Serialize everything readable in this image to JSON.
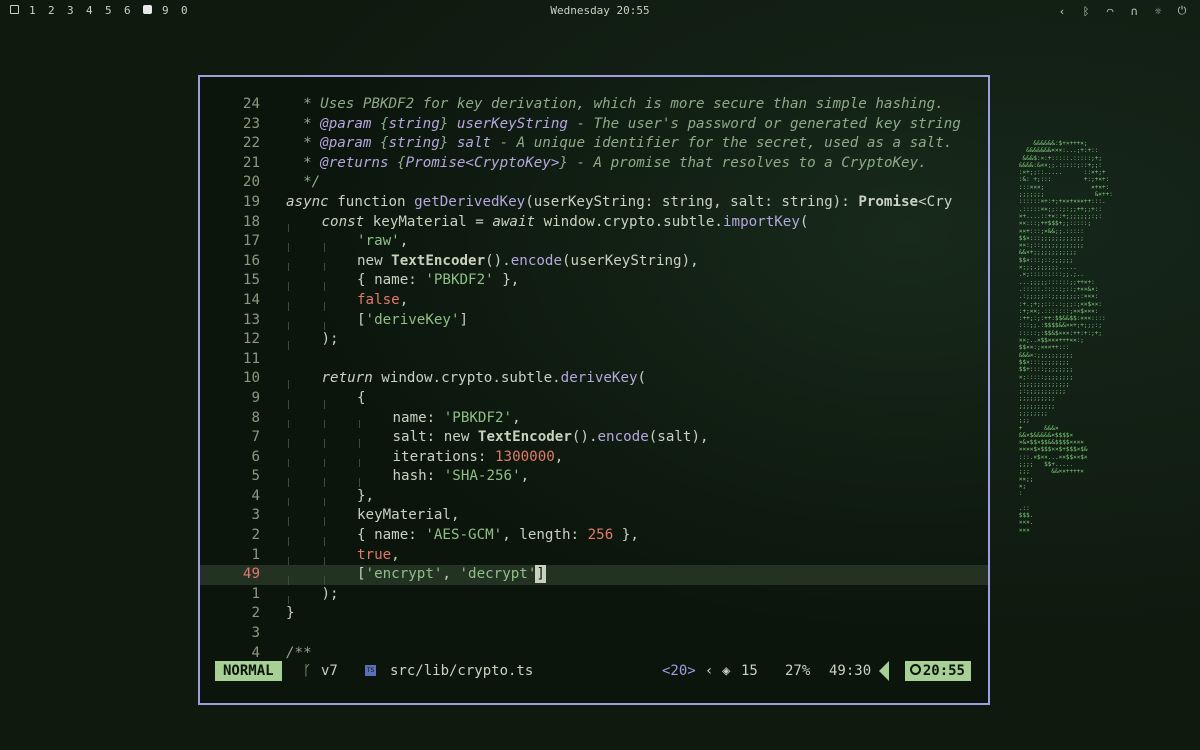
{
  "topbar": {
    "workspaces": [
      "1",
      "2",
      "3",
      "4",
      "5",
      "6",
      "9",
      "0"
    ],
    "active_workspace_index": 6,
    "clock": "Wednesday 20:55",
    "tray_icons": [
      "chevron-left-icon",
      "bluetooth-icon",
      "wifi-icon",
      "headphones-icon",
      "brightness-icon",
      "power-icon"
    ]
  },
  "editor": {
    "lines": [
      {
        "num": "24",
        "cur": false,
        "html": "<span class=\"cm\">  * Uses PBKDF2 for key derivation, which is more secure than simple hashing.</span>"
      },
      {
        "num": "23",
        "cur": false,
        "html": "<span class=\"cm\">  * </span><span class=\"cmk\">@param</span><span class=\"cm\"> {</span><span class=\"cmk\">string</span><span class=\"cm\">} </span><span class=\"cmk\">userKeyString</span><span class=\"cm\"> - The user's password or generated key string</span>"
      },
      {
        "num": "22",
        "cur": false,
        "html": "<span class=\"cm\">  * </span><span class=\"cmk\">@param</span><span class=\"cm\"> {</span><span class=\"cmk\">string</span><span class=\"cm\">} </span><span class=\"cmk\">salt</span><span class=\"cm\"> - A unique identifier for the secret, used as a salt.</span>"
      },
      {
        "num": "21",
        "cur": false,
        "html": "<span class=\"cm\">  * </span><span class=\"cmk\">@returns</span><span class=\"cm\"> {</span><span class=\"cmk\">Promise&lt;CryptoKey&gt;</span><span class=\"cm\">} - A promise that resolves to a CryptoKey.</span>"
      },
      {
        "num": "20",
        "cur": false,
        "html": "<span class=\"cm\">  */</span>"
      },
      {
        "num": "19",
        "cur": false,
        "html": "<span class=\"kwi\">async</span><span class=\"kw\"> function </span><span class=\"fn\">getDerivedKey</span><span class=\"plain\">(userKeyString: string, salt: string): </span><span class=\"bold\">Promise</span><span class=\"plain\">&lt;Cry</span>"
      },
      {
        "num": "18",
        "cur": false,
        "html": "<span class=\"guide\"></span><span class=\"kwi\">const</span><span class=\"plain\"> keyMaterial = </span><span class=\"kwi\">await</span><span class=\"plain\"> window.crypto.subtle.</span><span class=\"fn\">importKey</span><span class=\"plain\">(</span>"
      },
      {
        "num": "17",
        "cur": false,
        "html": "<span class=\"guide\"></span><span class=\"guide\"></span><span class=\"str\">'raw'</span><span class=\"plain\">,</span>"
      },
      {
        "num": "16",
        "cur": false,
        "html": "<span class=\"guide\"></span><span class=\"guide\"></span><span class=\"plain\">new </span><span class=\"bold\">TextEncoder</span><span class=\"plain\">().</span><span class=\"fn\">encode</span><span class=\"plain\">(userKeyString),</span>"
      },
      {
        "num": "15",
        "cur": false,
        "html": "<span class=\"guide\"></span><span class=\"guide\"></span><span class=\"plain\">{ name: </span><span class=\"str\">'PBKDF2'</span><span class=\"plain\"> },</span>"
      },
      {
        "num": "14",
        "cur": false,
        "html": "<span class=\"guide\"></span><span class=\"guide\"></span><span class=\"bool\">false</span><span class=\"plain\">,</span>"
      },
      {
        "num": "13",
        "cur": false,
        "html": "<span class=\"guide\"></span><span class=\"guide\"></span><span class=\"plain\">[</span><span class=\"str\">'deriveKey'</span><span class=\"plain\">]</span>"
      },
      {
        "num": "12",
        "cur": false,
        "html": "<span class=\"guide\"></span><span class=\"plain\">);</span>"
      },
      {
        "num": "11",
        "cur": false,
        "html": ""
      },
      {
        "num": "10",
        "cur": false,
        "html": "<span class=\"guide\"></span><span class=\"kwi\">return</span><span class=\"plain\"> window.crypto.subtle.</span><span class=\"fn\">deriveKey</span><span class=\"plain\">(</span>"
      },
      {
        "num": "9",
        "cur": false,
        "html": "<span class=\"guide\"></span><span class=\"guide\"></span><span class=\"plain\">{</span>"
      },
      {
        "num": "8",
        "cur": false,
        "html": "<span class=\"guide\"></span><span class=\"guide\"></span><span class=\"guide\"></span><span class=\"plain\">name: </span><span class=\"str\">'PBKDF2'</span><span class=\"plain\">,</span>"
      },
      {
        "num": "7",
        "cur": false,
        "html": "<span class=\"guide\"></span><span class=\"guide\"></span><span class=\"guide\"></span><span class=\"plain\">salt: new </span><span class=\"bold\">TextEncoder</span><span class=\"plain\">().</span><span class=\"fn\">encode</span><span class=\"plain\">(salt),</span>"
      },
      {
        "num": "6",
        "cur": false,
        "html": "<span class=\"guide\"></span><span class=\"guide\"></span><span class=\"guide\"></span><span class=\"plain\">iterations: </span><span class=\"num\">1300000</span><span class=\"plain\">,</span>"
      },
      {
        "num": "5",
        "cur": false,
        "html": "<span class=\"guide\"></span><span class=\"guide\"></span><span class=\"guide\"></span><span class=\"plain\">hash: </span><span class=\"str\">'SHA-256'</span><span class=\"plain\">,</span>"
      },
      {
        "num": "4",
        "cur": false,
        "html": "<span class=\"guide\"></span><span class=\"guide\"></span><span class=\"plain\">},</span>"
      },
      {
        "num": "3",
        "cur": false,
        "html": "<span class=\"guide\"></span><span class=\"guide\"></span><span class=\"plain\">keyMaterial,</span>"
      },
      {
        "num": "2",
        "cur": false,
        "html": "<span class=\"guide\"></span><span class=\"guide\"></span><span class=\"plain\">{ name: </span><span class=\"str\">'AES-GCM'</span><span class=\"plain\">, length: </span><span class=\"num\">256</span><span class=\"plain\"> },</span>"
      },
      {
        "num": "1",
        "cur": false,
        "html": "<span class=\"guide\"></span><span class=\"guide\"></span><span class=\"bool\">true</span><span class=\"plain\">,</span>"
      },
      {
        "num": "49",
        "cur": true,
        "html": "<span class=\"guide\"></span><span class=\"guide\"></span><span class=\"plain\">[</span><span class=\"str\">'encrypt'</span><span class=\"plain\">, </span><span class=\"str\">'decrypt'</span><span class=\"cur-box\">]</span>"
      },
      {
        "num": "1",
        "cur": false,
        "html": "<span class=\"guide\"></span><span class=\"plain\">);</span>"
      },
      {
        "num": "2",
        "cur": false,
        "html": "<span class=\"plain\">}</span>"
      },
      {
        "num": "3",
        "cur": false,
        "html": ""
      },
      {
        "num": "4",
        "cur": false,
        "html": "<span class=\"cm\">/**</span>"
      }
    ]
  },
  "statusline": {
    "mode": "NORMAL",
    "branch": "v7",
    "filetype_badge": "TS",
    "file": "src/lib/crypto.ts",
    "lsp": "<20>",
    "diagnostics": "15",
    "percent": "27%",
    "position": "49:30",
    "time": "20:55"
  },
  "ascii_art": "            &&&&&&:$+×+++×;\n          &&&&&&&×××:...;+:+::\n         &&&$:×:+:::::.:::::;+;\n        &&&&:&××;;.:::::;::+;;:\n        :×+;;::.....      ::×+;+\n        :&: +;:::         +:;+×+:\n        :::×××;             ×+×+:\n        ;;;;;;;              &×++:\n        ::::::×+:+;+××+×××++:::.\n        .:::::××;;::;:;;++;;+::\n        ×+....::+×::+;;;;;;;:;:\n        ××:::;++$$$+;;:::::;\n        ××+:::;×&&;;.:::::\n        $$×:::;;;;;;;;;;;;\n        ××:;::;;;;;;;;;;;;\n        &&×+;;;;;;;;;;;;\n        $$×:::;::;;;;;;\n        ×;;;.;;;;;;.....\n        .×;:::::::::;;.;..\n        ...;;;;;::::::;;++×+:\n        .:::::.:::::;::;+××&×:\n        .:;;;;;::;;;;;;;;:×××:\n        :+.;+;;:::.:;;;:;××$××:\n        :+;××;.:::::::;××$×××:\n        :++;:;:++:$$&&$$:×××::::\n        :::;;.:$$$$&&××+;+;;;:;\n        :::::;:$$&$×××:++:+:;+;\n        ××;..×$$×××+++××:;\n        $$××:;×××++:::\n        &&&×:;;;;;;;;;;\n        $$×:::;;;;;;;;\n        $$+::::;;;;;;;;\n        ×;:::::;;;;;;;;\n        ;;;;;;;;;;;;;;\n        ;:;;;;;;;;;;;\n        ;;;;;;;;;;\n        ;;;;;;;;;;\n        ;;;;;;;;\n        ;;;\n        +      &&&×\n        &&×$&&&&&×$$$$×\n        ×&×$$×$$&&$$$$××××\n        ××××$×$$$××$+$$$×$&\n        :::.×$××...××$$××$×\n        ;;;;   $$+.....\n        ;;;      &&××++++×\n        ××;;\n        ×;\n        :\n\n        .::\n        $$$.\n        ×××.\n        ×××"
}
